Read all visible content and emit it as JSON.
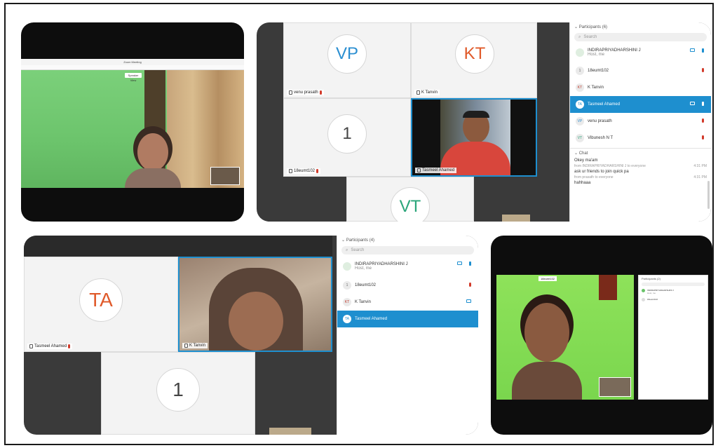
{
  "panel1": {
    "window_title": "Zoom Meeting",
    "speaker_view": "Speaker View"
  },
  "panel2": {
    "tiles": [
      {
        "initials": "VP",
        "label": "venu prasath",
        "color": "#2b8fd1"
      },
      {
        "initials": "KT",
        "label": "K Tanvin",
        "color": "#e05a2a"
      },
      {
        "initials": "1",
        "label": "18eumt102",
        "color": "#444444"
      },
      {
        "initials": "",
        "label": "Tasmeel Ahamed",
        "color": "#444444"
      }
    ],
    "bottom_initials": "VT",
    "participants_header": "Participants (6)",
    "search_placeholder": "Search",
    "participants": [
      {
        "initials": "",
        "name": "INDIRAPRIYADHARSHINI J",
        "sub": "Host, me"
      },
      {
        "initials": "1",
        "name": "18eumt102",
        "sub": ""
      },
      {
        "initials": "KT",
        "name": "K Tanvin",
        "sub": ""
      },
      {
        "initials": "TA",
        "name": "Tasmeel Ahamed",
        "sub": ""
      },
      {
        "initials": "VP",
        "name": "venu prasath",
        "sub": ""
      },
      {
        "initials": "VT",
        "name": "Vibunesh N T",
        "sub": ""
      }
    ],
    "chat_header": "Chat",
    "chat": [
      {
        "text": "Okey ma'am",
        "meta": "",
        "time": ""
      },
      {
        "text": "ask ur friends to join quick pa",
        "meta": "from INDIRAPRIYADHARSHINI J to everyone",
        "time": "4:31 PM"
      },
      {
        "text": "hahhaaa",
        "meta": "from prasath to everyone",
        "time": "4:31 PM"
      }
    ]
  },
  "panel3": {
    "tiles": [
      {
        "initials": "TA",
        "label": "Tasmeel Ahamed"
      },
      {
        "initials": "",
        "label": "K Tanvin"
      },
      {
        "initials": "1",
        "label": ""
      }
    ],
    "participants_header": "Participants (4)",
    "search_placeholder": "Search",
    "participants": [
      {
        "initials": "",
        "name": "INDIRAPRIYADHARSHINI J",
        "sub": "Host, me"
      },
      {
        "initials": "1",
        "name": "18eumt102",
        "sub": ""
      },
      {
        "initials": "KT",
        "name": "K Tanvin",
        "sub": ""
      },
      {
        "initials": "TA",
        "name": "Tasmeel Ahamed",
        "sub": ""
      }
    ]
  },
  "panel4": {
    "participants_header": "Participants (2)",
    "participants": [
      {
        "name": "INDIRAPRIYADHARSHINI J",
        "sub": "Host, me"
      },
      {
        "name": "18eumt102",
        "sub": ""
      }
    ],
    "tile_label": "18eumt102"
  },
  "colors": {
    "accent": "#1e8fcf",
    "video_green": "#6cc46c",
    "mic_muted": "#d23a2a"
  }
}
